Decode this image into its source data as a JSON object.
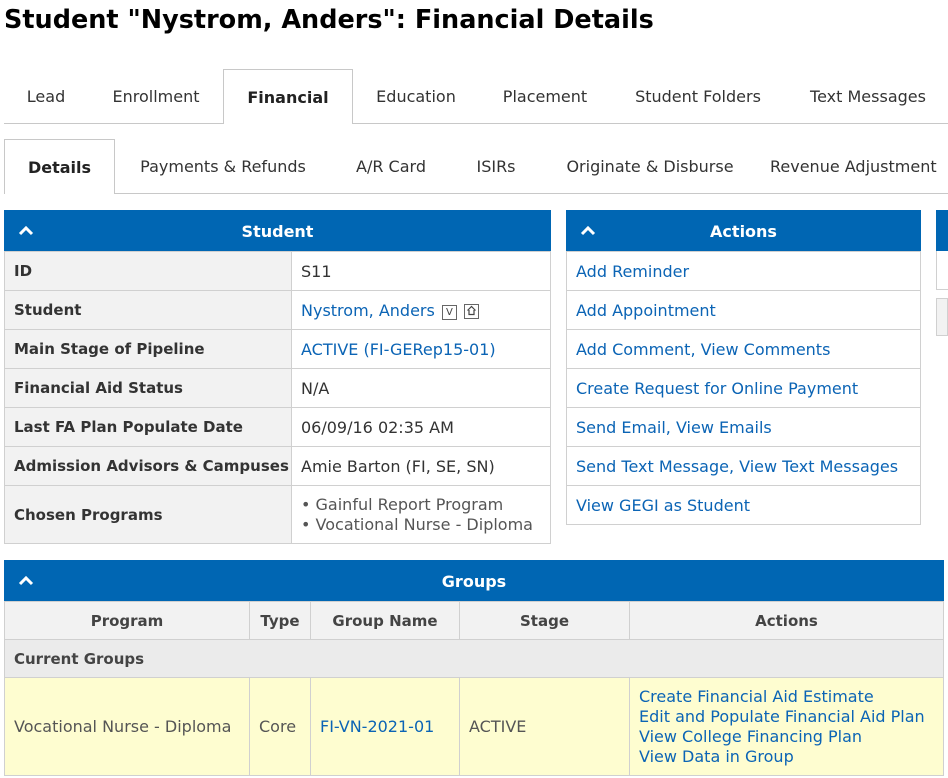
{
  "page_title": "Student \"Nystrom, Anders\": Financial Details",
  "main_tabs": [
    {
      "label": "Lead",
      "active": false
    },
    {
      "label": "Enrollment",
      "active": false
    },
    {
      "label": "Financial",
      "active": true
    },
    {
      "label": "Education",
      "active": false
    },
    {
      "label": "Placement",
      "active": false
    },
    {
      "label": "Student Folders",
      "active": false
    },
    {
      "label": "Text Messages",
      "active": false
    }
  ],
  "sub_tabs": [
    {
      "label": "Details",
      "active": true
    },
    {
      "label": "Payments & Refunds",
      "active": false
    },
    {
      "label": "A/R Card",
      "active": false
    },
    {
      "label": "ISIRs",
      "active": false
    },
    {
      "label": "Originate & Disburse",
      "active": false
    },
    {
      "label": "Revenue Adjustment",
      "active": false
    }
  ],
  "student_panel": {
    "title": "Student",
    "rows": [
      {
        "label": "ID",
        "value": "S11"
      },
      {
        "label": "Student",
        "value": "Nystrom, Anders",
        "icons": [
          "V",
          "home-icon"
        ]
      },
      {
        "label": "Main Stage of Pipeline",
        "value": "ACTIVE (FI-GERep15-01)"
      },
      {
        "label": "Financial Aid Status",
        "value": "N/A"
      },
      {
        "label": "Last FA Plan Populate Date",
        "value": "06/09/16 02:35 AM"
      },
      {
        "label": "Admission Advisors & Campuses",
        "value": "Amie Barton (FI, SE, SN)"
      },
      {
        "label": "Chosen Programs",
        "values": [
          "Gainful Report Program",
          "Vocational Nurse - Diploma"
        ]
      }
    ]
  },
  "actions_panel": {
    "title": "Actions",
    "items": {
      "add_reminder": "Add Reminder",
      "add_appointment": "Add Appointment",
      "add_comment": "Add Comment",
      "view_comments": "View Comments",
      "create_request": "Create Request for Online Payment",
      "send_email": "Send Email",
      "view_emails": "View Emails",
      "send_text": "Send Text Message",
      "view_texts": "View Text Messages",
      "view_gegi": "View GEGI as Student"
    },
    "separator": ", "
  },
  "groups_panel": {
    "title": "Groups",
    "columns": [
      "Program",
      "Type",
      "Group Name",
      "Stage",
      "Actions"
    ],
    "section_label": "Current Groups",
    "row": {
      "program": "Vocational Nurse - Diploma",
      "type": "Core",
      "group_name": "FI-VN-2021-01",
      "stage": "ACTIVE",
      "actions": [
        "Create Financial Aid Estimate",
        "Edit and Populate Financial Aid Plan",
        "View College Financing Plan",
        "View Data in Group"
      ]
    }
  },
  "colors": {
    "header_blue": "#0066b3",
    "link": "#0b64b5",
    "highlight_row": "#fefdd0"
  }
}
